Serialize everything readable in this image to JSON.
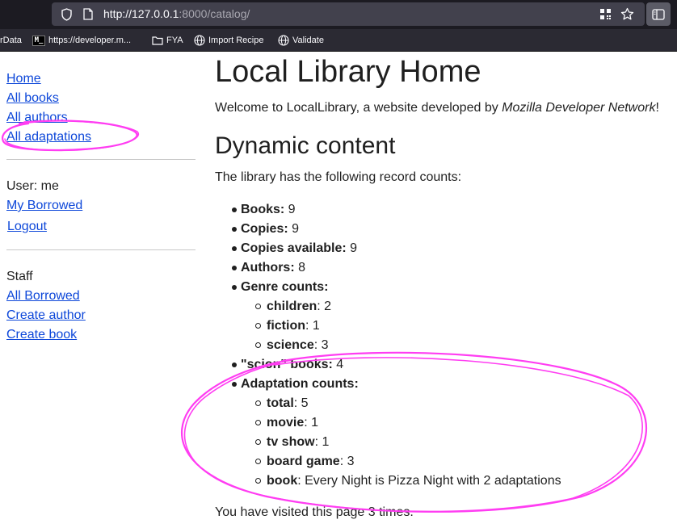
{
  "browser": {
    "url_host": "http://127.0.0.1",
    "url_rest": ":8000/catalog/",
    "bookmarks": [
      {
        "label": "rData"
      },
      {
        "label": "https://developer.m...",
        "logo_text": "M_"
      },
      {
        "label": "FYA"
      },
      {
        "label": "Import Recipe"
      },
      {
        "label": "Validate"
      }
    ]
  },
  "sidebar": {
    "nav": [
      "Home",
      "All books",
      "All authors",
      "All adaptations"
    ],
    "user_label": "User: me",
    "user_links": [
      "My Borrowed",
      "Logout"
    ],
    "staff_label": "Staff",
    "staff_links": [
      "All Borrowed",
      "Create author",
      "Create book"
    ]
  },
  "main": {
    "title": "Local Library Home",
    "welcome_prefix": "Welcome to LocalLibrary, a website developed by ",
    "welcome_em": "Mozilla Developer Network",
    "welcome_suffix": "!",
    "dynamic_heading": "Dynamic content",
    "record_intro": "The library has the following record counts:",
    "counts": [
      {
        "label": "Books:",
        "value": " 9"
      },
      {
        "label": "Copies:",
        "value": " 9"
      },
      {
        "label": "Copies available:",
        "value": " 9"
      },
      {
        "label": "Authors:",
        "value": " 8"
      },
      {
        "label": "Genre counts:",
        "value": ""
      }
    ],
    "genres": [
      {
        "label": "children",
        "value": ": 2"
      },
      {
        "label": "fiction",
        "value": ": 1"
      },
      {
        "label": "science",
        "value": ": 3"
      }
    ],
    "scion_label": "\"scion\" books:",
    "scion_value": " 4",
    "adaptation_label": "Adaptation counts:",
    "adaptations": [
      {
        "label": "total",
        "value": ": 5"
      },
      {
        "label": "movie",
        "value": ": 1"
      },
      {
        "label": "tv show",
        "value": ": 1"
      },
      {
        "label": "board game",
        "value": ": 3"
      },
      {
        "label": "book",
        "value": ": Every Night is Pizza Night with 2 adaptations"
      }
    ],
    "visits": "You have visited this page 3 times."
  },
  "colors": {
    "annotation": "#ff3df2",
    "link": "#0d47d9",
    "chrome": "#1c1b22"
  }
}
